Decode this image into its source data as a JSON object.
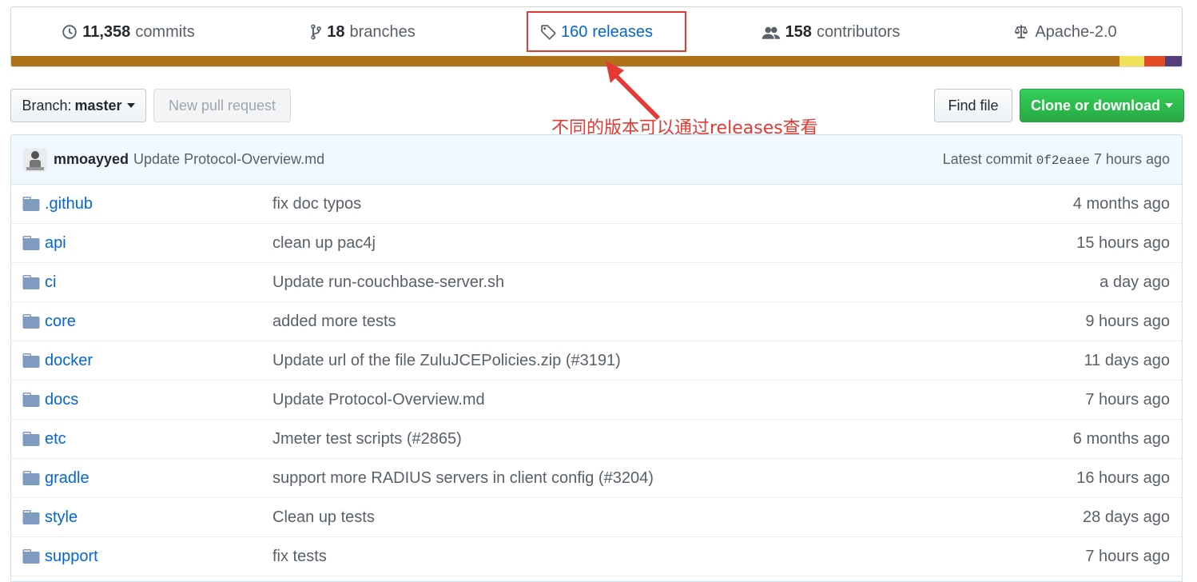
{
  "summary": {
    "commits": {
      "num": "11,358",
      "label": "commits",
      "icon": "history-icon"
    },
    "branches": {
      "num": "18",
      "label": "branches",
      "icon": "git-branch-icon"
    },
    "releases": {
      "num": "160",
      "label": "releases",
      "icon": "tag-icon"
    },
    "contributors": {
      "num": "158",
      "label": "contributors",
      "icon": "people-icon"
    },
    "license": {
      "label": "Apache-2.0",
      "icon": "law-icon"
    }
  },
  "language_bar_colors": [
    "#b07219",
    "#f1e05a",
    "#e34c26",
    "#563d7c"
  ],
  "annotation": {
    "text": "不同的版本可以通过releases查看",
    "color": "#e53935"
  },
  "toolbar": {
    "branch_label": "Branch:",
    "branch_value": "master",
    "new_pr": "New pull request",
    "find_file": "Find file",
    "clone": "Clone or download"
  },
  "latest_commit": {
    "author": "mmoayyed",
    "message": "Update Protocol-Overview.md",
    "prefix": "Latest commit",
    "sha": "0f2eaee",
    "age": "7 hours ago"
  },
  "files": [
    {
      "name": ".github",
      "message": "fix doc typos",
      "age": "4 months ago"
    },
    {
      "name": "api",
      "message": "clean up pac4j",
      "age": "15 hours ago"
    },
    {
      "name": "ci",
      "message": "Update run-couchbase-server.sh",
      "age": "a day ago"
    },
    {
      "name": "core",
      "message": "added more tests",
      "age": "9 hours ago"
    },
    {
      "name": "docker",
      "message": "Update url of the file ZuluJCEPolicies.zip (#3191)",
      "age": "11 days ago"
    },
    {
      "name": "docs",
      "message": "Update Protocol-Overview.md",
      "age": "7 hours ago"
    },
    {
      "name": "etc",
      "message": "Jmeter test scripts (#2865)",
      "age": "6 months ago"
    },
    {
      "name": "gradle",
      "message": "support more RADIUS servers in client config (#3204)",
      "age": "16 hours ago"
    },
    {
      "name": "style",
      "message": "Clean up tests",
      "age": "28 days ago"
    },
    {
      "name": "support",
      "message": "fix tests",
      "age": "7 hours ago"
    }
  ]
}
